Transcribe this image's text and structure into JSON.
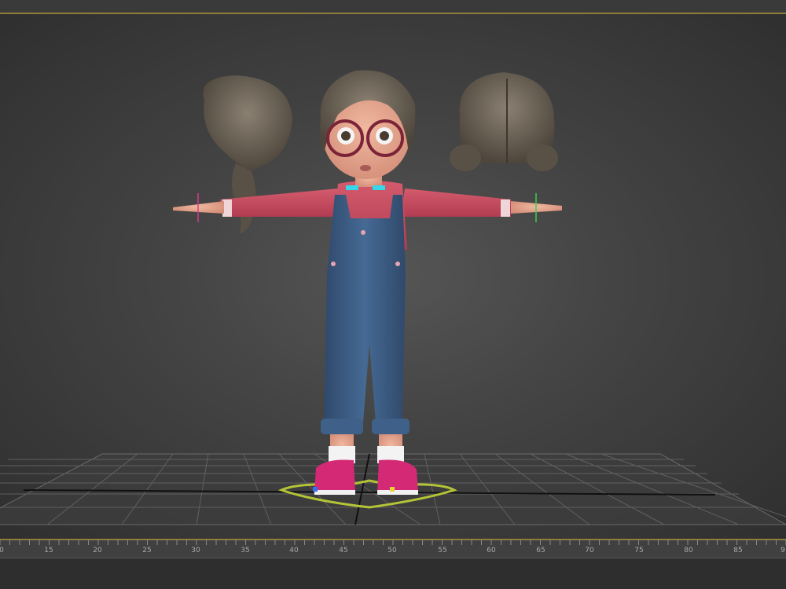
{
  "viewport": {
    "name": "3D perspective viewport",
    "background_colors": [
      "#555555",
      "#2f2f2f"
    ],
    "accent_border": "#8f7d3c",
    "character": {
      "shirt_color": "#c8475c",
      "overalls_color": "#3c5c84",
      "shoe_color": "#d42a76",
      "hair_color": "#6e6458",
      "skin_color": "#e6a48e"
    }
  },
  "timeline": {
    "ruler_labels": [
      "0",
      "15",
      "20",
      "25",
      "30",
      "35",
      "40",
      "45",
      "50",
      "55",
      "60",
      "65",
      "70",
      "75",
      "80",
      "85",
      "9"
    ]
  }
}
